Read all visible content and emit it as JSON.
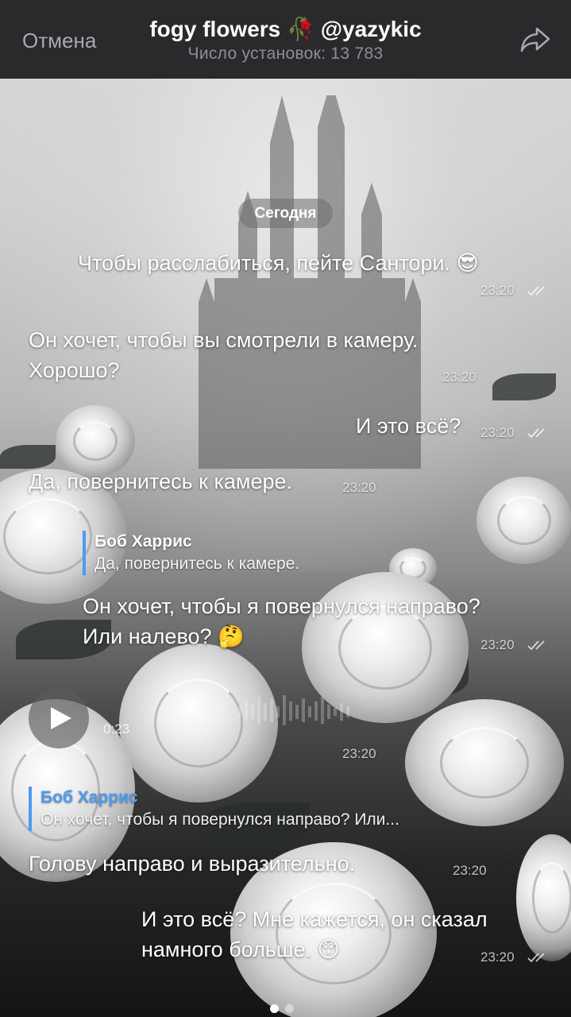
{
  "header": {
    "cancel_label": "Отмена",
    "title_text": "fogy flowers",
    "title_emoji": "🥀",
    "title_handle": "@yazykic",
    "subtitle": "Число установок: 13 783",
    "share_icon": "share-arrow-icon"
  },
  "chat": {
    "date_separator": "Сегодня",
    "messages": [
      {
        "text": "Чтобы расслабиться, пейте Сантори.",
        "emoji": "😎",
        "time": "23:20",
        "outgoing": true
      },
      {
        "line1": "Он хочет, чтобы вы смотрели в камеру.",
        "line2": "Хорошо?",
        "time": "23:20",
        "outgoing": false
      },
      {
        "text": "И это всё?",
        "time": "23:20",
        "outgoing": true
      },
      {
        "text": "Да, повернитесь к камере.",
        "time": "23:20",
        "outgoing": false
      },
      {
        "reply_name": "Боб Харрис",
        "reply_text": "Да, повернитесь к камере.",
        "line1": "Он хочет, чтобы я повернулся направо?",
        "line2": "Или налево?",
        "emoji": "🤔",
        "time": "23:20",
        "outgoing": true
      },
      {
        "voice_duration": "0:23",
        "time": "23:20",
        "outgoing": false
      },
      {
        "reply_name": "Боб Харрис",
        "reply_text": "Он хочет, чтобы я повернулся направо? Или...",
        "text": "Голову направо и выразительно.",
        "time": "23:20",
        "outgoing": false
      },
      {
        "line1": "И это всё? Мне кажется, он сказал",
        "line2": "намного больше.",
        "emoji": "😯",
        "time": "23:20",
        "outgoing": true
      }
    ]
  },
  "pager": {
    "total": 2,
    "active": 1
  },
  "colors": {
    "nav_bg": "#2a2a2c",
    "reply_accent": "#4d9bf0",
    "title_text": "#ffffff",
    "subtitle_text": "#8e8e93"
  }
}
